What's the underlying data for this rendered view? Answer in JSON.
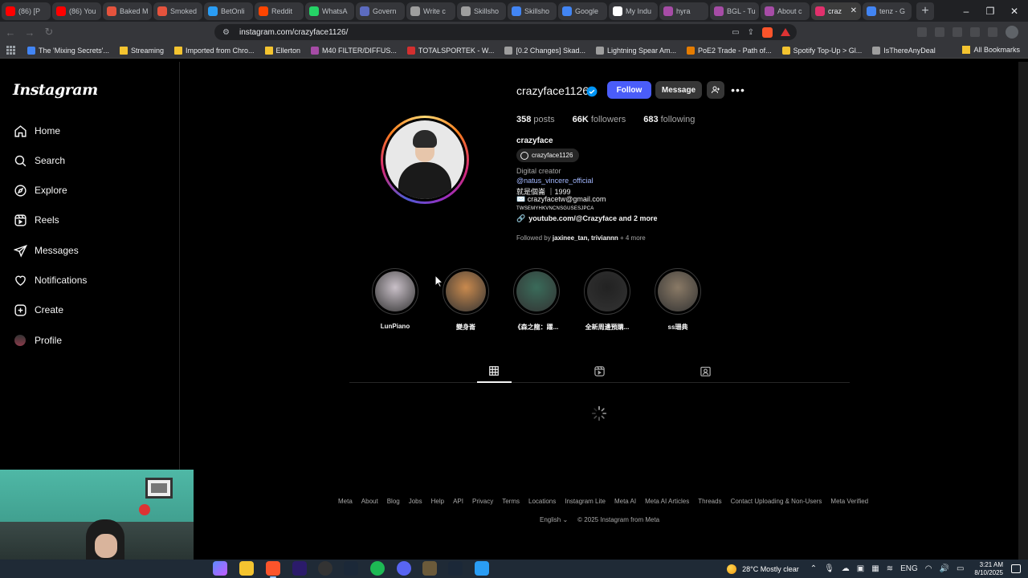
{
  "browser": {
    "tabs": [
      {
        "label": "(86) [P",
        "color": "#ff0000"
      },
      {
        "label": "(86) You",
        "color": "#ff0000"
      },
      {
        "label": "Baked M",
        "color": "#e5533d"
      },
      {
        "label": "Smoked",
        "color": "#e5533d"
      },
      {
        "label": "BetOnli",
        "color": "#2a9df4"
      },
      {
        "label": "Reddit",
        "color": "#ff4500"
      },
      {
        "label": "WhatsA",
        "color": "#25d366"
      },
      {
        "label": "Govern",
        "color": "#5c6bc0"
      },
      {
        "label": "Write c",
        "color": "#9e9e9e"
      },
      {
        "label": "Skillsho",
        "color": "#9e9e9e"
      },
      {
        "label": "Skillsho",
        "color": "#4285f4"
      },
      {
        "label": "Google",
        "color": "#4285f4"
      },
      {
        "label": "My Indu",
        "color": "#ffffff"
      },
      {
        "label": "hyra",
        "color": "#a64ca6"
      },
      {
        "label": "BGL - Tu",
        "color": "#a64ca6"
      },
      {
        "label": "About c",
        "color": "#a64ca6"
      },
      {
        "label": "craz",
        "color": "#e1306c",
        "active": true
      },
      {
        "label": "tenz - G",
        "color": "#4285f4"
      }
    ],
    "url": "instagram.com/crazyface1126/",
    "bookmarks": [
      {
        "label": "The 'Mixing Secrets'...",
        "color": "#4285f4",
        "folder": false
      },
      {
        "label": "Streaming",
        "color": "#f4c430",
        "folder": true
      },
      {
        "label": "Imported from Chro...",
        "color": "#f4c430",
        "folder": true
      },
      {
        "label": "Ellerton",
        "color": "#f4c430",
        "folder": true
      },
      {
        "label": "M40 FILTER/DIFFUS...",
        "color": "#a64ca6",
        "folder": false
      },
      {
        "label": "TOTALSPORTEK - W...",
        "color": "#d32f2f",
        "folder": false
      },
      {
        "label": "[0.2 Changes] Skad...",
        "color": "#9e9e9e",
        "folder": false
      },
      {
        "label": "Lightning Spear Am...",
        "color": "#9e9e9e",
        "folder": false
      },
      {
        "label": "PoE2 Trade - Path of...",
        "color": "#e57c00",
        "folder": false
      },
      {
        "label": "Spotify Top-Up > Gl...",
        "color": "#f4c430",
        "folder": false
      },
      {
        "label": "IsThereAnyDeal",
        "color": "#9e9e9e",
        "folder": false
      }
    ],
    "all_bookmarks": "All Bookmarks"
  },
  "nav": {
    "logo": "Instagram",
    "items": [
      {
        "label": "Home",
        "icon": "home-icon"
      },
      {
        "label": "Search",
        "icon": "search-icon"
      },
      {
        "label": "Explore",
        "icon": "compass-icon"
      },
      {
        "label": "Reels",
        "icon": "reels-icon"
      },
      {
        "label": "Messages",
        "icon": "send-icon"
      },
      {
        "label": "Notifications",
        "icon": "heart-icon"
      },
      {
        "label": "Create",
        "icon": "plus-square-icon"
      },
      {
        "label": "Profile",
        "icon": "avatar-icon"
      }
    ]
  },
  "profile": {
    "username": "crazyface1126",
    "follow_label": "Follow",
    "message_label": "Message",
    "posts_count": "358",
    "posts_label": "posts",
    "followers_count": "66K",
    "followers_label": "followers",
    "following_count": "683",
    "following_label": "following",
    "full_name": "crazyface",
    "threads_handle": "crazyface1126",
    "category": "Digital creator",
    "bio_mention": "@natus_vincere_official",
    "bio_line1": "就是個崙 ｜1999",
    "bio_email": "✉️ crazyfacetw@gmail.com",
    "bio_code": "TWSEMYHKVNCNSGUSESJPCA",
    "bio_link": "youtube.com/@Crazyface and 2 more",
    "followed_by_prefix": "Followed by ",
    "followed_by_names": "jaxinee_tan, triviannn",
    "followed_by_suffix": " + 4 more"
  },
  "highlights": [
    {
      "label": "LunPiano",
      "color": "#c9c0c8"
    },
    {
      "label": "變身崙",
      "color": "#c98a4e"
    },
    {
      "label": "《森之龍：躍...",
      "color": "#3a6b5a"
    },
    {
      "label": "全新周邊預購...",
      "color": "#222222"
    },
    {
      "label": "ss珊典",
      "color": "#8a7a66"
    }
  ],
  "footer": {
    "links": [
      "Meta",
      "About",
      "Blog",
      "Jobs",
      "Help",
      "API",
      "Privacy",
      "Terms",
      "Locations",
      "Instagram Lite",
      "Meta AI",
      "Meta AI Articles",
      "Threads",
      "Contact Uploading & Non-Users",
      "Meta Verified"
    ],
    "language": "English ⌄",
    "copyright": "© 2025 Instagram from Meta"
  },
  "taskbar": {
    "weather": "28°C  Mostly clear",
    "lang": "ENG",
    "time": "3:21 AM",
    "date": "8/10/2025"
  }
}
